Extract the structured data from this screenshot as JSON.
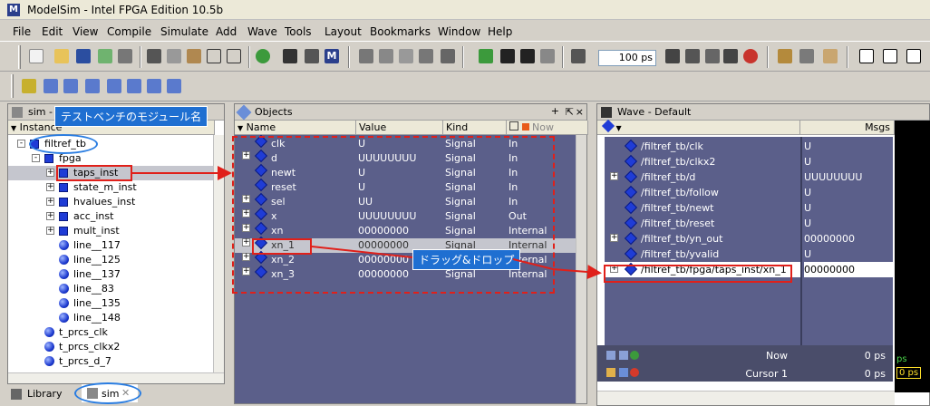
{
  "window": {
    "title": "ModelSim - Intel FPGA Edition 10.5b",
    "icon": "modelsim-logo-icon"
  },
  "menu": [
    "File",
    "Edit",
    "View",
    "Compile",
    "Simulate",
    "Add",
    "Wave",
    "Tools",
    "Layout",
    "Bookmarks",
    "Window",
    "Help"
  ],
  "toolbar": {
    "run_length": "100 ps"
  },
  "sim_pane": {
    "title": "sim - D",
    "column": "Instance",
    "tree": [
      {
        "label": "filtref_tb",
        "indent": 0,
        "icon": "module-icon",
        "expander": "-"
      },
      {
        "label": "fpga",
        "indent": 1,
        "icon": "module-icon",
        "expander": "-"
      },
      {
        "label": "taps_inst",
        "indent": 2,
        "icon": "module-icon",
        "expander": "+",
        "selected": true
      },
      {
        "label": "state_m_inst",
        "indent": 2,
        "icon": "module-icon",
        "expander": "+"
      },
      {
        "label": "hvalues_inst",
        "indent": 2,
        "icon": "module-icon",
        "expander": "+"
      },
      {
        "label": "acc_inst",
        "indent": 2,
        "icon": "module-icon",
        "expander": "+"
      },
      {
        "label": "mult_inst",
        "indent": 2,
        "icon": "module-icon",
        "expander": "+"
      },
      {
        "label": "line__117",
        "indent": 2,
        "icon": "process-icon"
      },
      {
        "label": "line__125",
        "indent": 2,
        "icon": "process-icon"
      },
      {
        "label": "line__137",
        "indent": 2,
        "icon": "process-icon"
      },
      {
        "label": "line__83",
        "indent": 2,
        "icon": "process-icon"
      },
      {
        "label": "line__135",
        "indent": 2,
        "icon": "process-icon"
      },
      {
        "label": "line__148",
        "indent": 2,
        "icon": "process-icon"
      },
      {
        "label": "t_prcs_clk",
        "indent": 1,
        "icon": "process-icon"
      },
      {
        "label": "t_prcs_clkx2",
        "indent": 1,
        "icon": "process-icon"
      },
      {
        "label": "t_prcs_d_7",
        "indent": 1,
        "icon": "process-icon"
      }
    ],
    "tabs": [
      {
        "label": "Library"
      },
      {
        "label": "sim"
      }
    ]
  },
  "objects_pane": {
    "title": "Objects",
    "columns": [
      "Name",
      "Value",
      "Kind",
      "Now"
    ],
    "rows": [
      {
        "name": "clk",
        "value": "U",
        "kind": "Signal",
        "mode": "In",
        "expander": false
      },
      {
        "name": "d",
        "value": "UUUUUUUU",
        "kind": "Signal",
        "mode": "In",
        "expander": true
      },
      {
        "name": "newt",
        "value": "U",
        "kind": "Signal",
        "mode": "In",
        "expander": false
      },
      {
        "name": "reset",
        "value": "U",
        "kind": "Signal",
        "mode": "In",
        "expander": false
      },
      {
        "name": "sel",
        "value": "UU",
        "kind": "Signal",
        "mode": "In",
        "expander": true
      },
      {
        "name": "x",
        "value": "UUUUUUUU",
        "kind": "Signal",
        "mode": "Out",
        "expander": true
      },
      {
        "name": "xn",
        "value": "00000000",
        "kind": "Signal",
        "mode": "Internal",
        "expander": true
      },
      {
        "name": "xn_1",
        "value": "00000000",
        "kind": "Signal",
        "mode": "Internal",
        "expander": true,
        "selected": true
      },
      {
        "name": "xn_2",
        "value": "00000000",
        "kind": "Signal",
        "mode": "Internal",
        "expander": true
      },
      {
        "name": "xn_3",
        "value": "00000000",
        "kind": "Signal",
        "mode": "Internal",
        "expander": true
      }
    ]
  },
  "wave_pane": {
    "title": "Wave - Default",
    "msgs_header": "Msgs",
    "rows": [
      {
        "name": "/filtref_tb/clk",
        "value": "U",
        "expander": false
      },
      {
        "name": "/filtref_tb/clkx2",
        "value": "U",
        "expander": false
      },
      {
        "name": "/filtref_tb/d",
        "value": "UUUUUUUU",
        "expander": true
      },
      {
        "name": "/filtref_tb/follow",
        "value": "U",
        "expander": false
      },
      {
        "name": "/filtref_tb/newt",
        "value": "U",
        "expander": false
      },
      {
        "name": "/filtref_tb/reset",
        "value": "U",
        "expander": false
      },
      {
        "name": "/filtref_tb/yn_out",
        "value": "00000000",
        "expander": true
      },
      {
        "name": "/filtref_tb/yvalid",
        "value": "U",
        "expander": false
      },
      {
        "name": "/filtref_tb/fpga/taps_inst/xn_1",
        "value": "00000000",
        "expander": true,
        "dropped": true
      }
    ],
    "now_label": "Now",
    "now_value": "0 ps",
    "cursor_label": "Cursor 1",
    "cursor_value": "0 ps",
    "ps_marker": "ps",
    "cursor_marker": "0 ps"
  },
  "annotations": {
    "testbench_callout": "テストベンチのモジュール名",
    "drag_drop_callout": "ドラッグ&ドロップ"
  },
  "colors": {
    "pane_bg": "#5b5f8a",
    "accent_red": "#e0201a",
    "accent_blue": "#2a7de1"
  }
}
